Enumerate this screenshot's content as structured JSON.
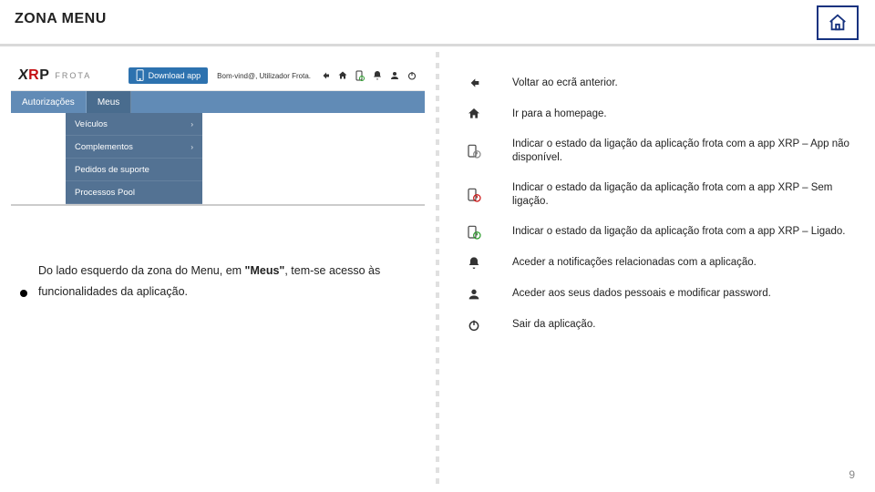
{
  "header": {
    "title": "ZONA MENU"
  },
  "appbar": {
    "logo_main": "XRP",
    "logo_sub": "FROTA",
    "download": "Download app",
    "welcome": "Bom-vind@, Utilizador Frota."
  },
  "nav": {
    "item0": "Autorizações",
    "item1": "Meus"
  },
  "dropdown": {
    "i0": "Veículos",
    "i1": "Complementos",
    "i2": "Pedidos de suporte",
    "i3": "Processos Pool"
  },
  "body": {
    "p1a": "Do lado esquerdo da zona do Menu, em ",
    "p1b": "\"Meus\"",
    "p1c": ", tem-se acesso às funcionalidades da aplicação."
  },
  "legend": {
    "r0": "Voltar ao ecrã anterior.",
    "r1": "Ir para a homepage.",
    "r2": "Indicar o estado da ligação da aplicação frota com a app XRP – App não disponível.",
    "r3": "Indicar o estado da ligação da aplicação frota com a app XRP – Sem ligação.",
    "r4": "Indicar o estado da ligação da aplicação frota com a app XRP – Ligado.",
    "r5": "Aceder a notificações relacionadas com a aplicação.",
    "r6": "Aceder aos seus dados pessoais e modificar password.",
    "r7": "Sair da aplicação."
  },
  "page_number": "9"
}
